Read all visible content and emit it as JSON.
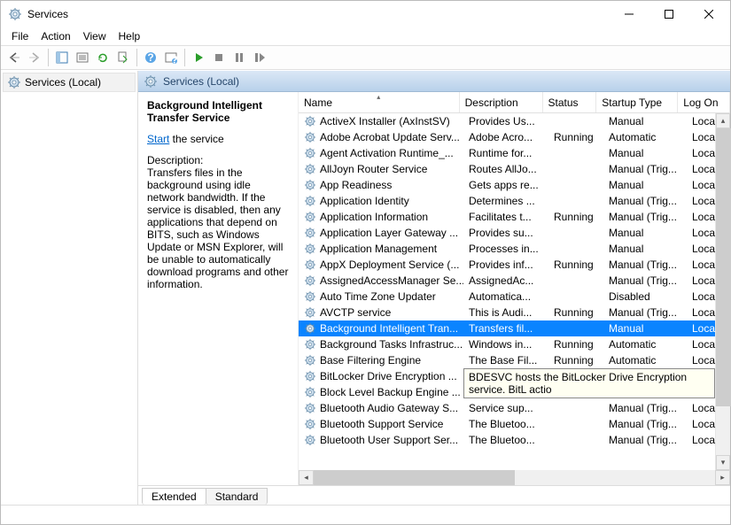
{
  "window": {
    "title": "Services"
  },
  "menu": {
    "file": "File",
    "action": "Action",
    "view": "View",
    "help": "Help"
  },
  "nav": {
    "root": "Services (Local)"
  },
  "header": {
    "title": "Services (Local)"
  },
  "detail": {
    "name": "Background Intelligent Transfer Service",
    "start_link": "Start",
    "start_rest": " the service",
    "desc_label": "Description:",
    "description": "Transfers files in the background using idle network bandwidth. If the service is disabled, then any applications that depend on BITS, such as Windows Update or MSN Explorer, will be unable to automatically download programs and other information."
  },
  "columns": {
    "name": "Name",
    "description": "Description",
    "status": "Status",
    "startup": "Startup Type",
    "logon": "Log On"
  },
  "tooltip": "BDESVC hosts the BitLocker Drive Encryption service. BitL\nactio",
  "tabs": {
    "extended": "Extended",
    "standard": "Standard"
  },
  "services": [
    {
      "name": "ActiveX Installer (AxInstSV)",
      "desc": "Provides Us...",
      "status": "",
      "startup": "Manual",
      "logon": "Local Sy"
    },
    {
      "name": "Adobe Acrobat Update Serv...",
      "desc": "Adobe Acro...",
      "status": "Running",
      "startup": "Automatic",
      "logon": "Local Sy"
    },
    {
      "name": "Agent Activation Runtime_...",
      "desc": "Runtime for...",
      "status": "",
      "startup": "Manual",
      "logon": "Local Sy"
    },
    {
      "name": "AllJoyn Router Service",
      "desc": "Routes AllJo...",
      "status": "",
      "startup": "Manual (Trig...",
      "logon": "Local Se"
    },
    {
      "name": "App Readiness",
      "desc": "Gets apps re...",
      "status": "",
      "startup": "Manual",
      "logon": "Local Sy"
    },
    {
      "name": "Application Identity",
      "desc": "Determines ...",
      "status": "",
      "startup": "Manual (Trig...",
      "logon": "Local Se"
    },
    {
      "name": "Application Information",
      "desc": "Facilitates t...",
      "status": "Running",
      "startup": "Manual (Trig...",
      "logon": "Local Sy"
    },
    {
      "name": "Application Layer Gateway ...",
      "desc": "Provides su...",
      "status": "",
      "startup": "Manual",
      "logon": "Local Se"
    },
    {
      "name": "Application Management",
      "desc": "Processes in...",
      "status": "",
      "startup": "Manual",
      "logon": "Local Sy"
    },
    {
      "name": "AppX Deployment Service (...",
      "desc": "Provides inf...",
      "status": "Running",
      "startup": "Manual (Trig...",
      "logon": "Local Sy"
    },
    {
      "name": "AssignedAccessManager Se...",
      "desc": "AssignedAc...",
      "status": "",
      "startup": "Manual (Trig...",
      "logon": "Local Sy"
    },
    {
      "name": "Auto Time Zone Updater",
      "desc": "Automatica...",
      "status": "",
      "startup": "Disabled",
      "logon": "Local Se"
    },
    {
      "name": "AVCTP service",
      "desc": "This is Audi...",
      "status": "Running",
      "startup": "Manual (Trig...",
      "logon": "Local Se"
    },
    {
      "name": "Background Intelligent Tran...",
      "desc": "Transfers fil...",
      "status": "",
      "startup": "Manual",
      "logon": "Local Sy",
      "selected": true
    },
    {
      "name": "Background Tasks Infrastruc...",
      "desc": "Windows in...",
      "status": "Running",
      "startup": "Automatic",
      "logon": "Local Sy"
    },
    {
      "name": "Base Filtering Engine",
      "desc": "The Base Fil...",
      "status": "Running",
      "startup": "Automatic",
      "logon": "Local Se"
    },
    {
      "name": "BitLocker Drive Encryption ...",
      "desc": "",
      "status": "",
      "startup": "",
      "logon": ""
    },
    {
      "name": "Block Level Backup Engine ...",
      "desc": "",
      "status": "",
      "startup": "",
      "logon": ""
    },
    {
      "name": "Bluetooth Audio Gateway S...",
      "desc": "Service sup...",
      "status": "",
      "startup": "Manual (Trig...",
      "logon": "Local Se"
    },
    {
      "name": "Bluetooth Support Service",
      "desc": "The Bluetoo...",
      "status": "",
      "startup": "Manual (Trig...",
      "logon": "Local Se"
    },
    {
      "name": "Bluetooth User Support Ser...",
      "desc": "The Bluetoo...",
      "status": "",
      "startup": "Manual (Trig...",
      "logon": "Local Sy"
    }
  ]
}
